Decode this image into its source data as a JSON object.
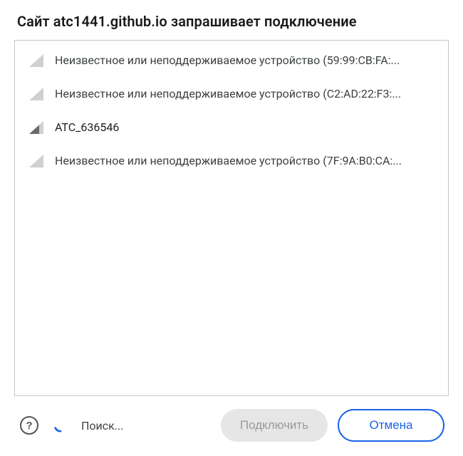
{
  "title": "Сайт atc1441.github.io запрашивает подключение",
  "devices": [
    {
      "label": "Неизвестное или неподдерживаемое устройство (59:99:CB:FA:...",
      "signal": "weak"
    },
    {
      "label": "Неизвестное или неподдерживаемое устройство (C2:AD:22:F3:...",
      "signal": "weak"
    },
    {
      "label": "ATC_636546",
      "signal": "strong"
    },
    {
      "label": "Неизвестное или неподдерживаемое устройство (7F:9A:B0:CA:...",
      "signal": "weak"
    }
  ],
  "footer": {
    "help_tooltip": "Справка",
    "scanning_label": "Поиск...",
    "connect_label": "Подключить",
    "cancel_label": "Отмена"
  },
  "colors": {
    "accent": "#1a63e6",
    "border": "#c7c7c7",
    "weak_signal": "#d0d0d0",
    "strong_signal": "#6a6a6a",
    "disabled_bg": "#e6e6e6",
    "disabled_fg": "#9a9a9a"
  }
}
